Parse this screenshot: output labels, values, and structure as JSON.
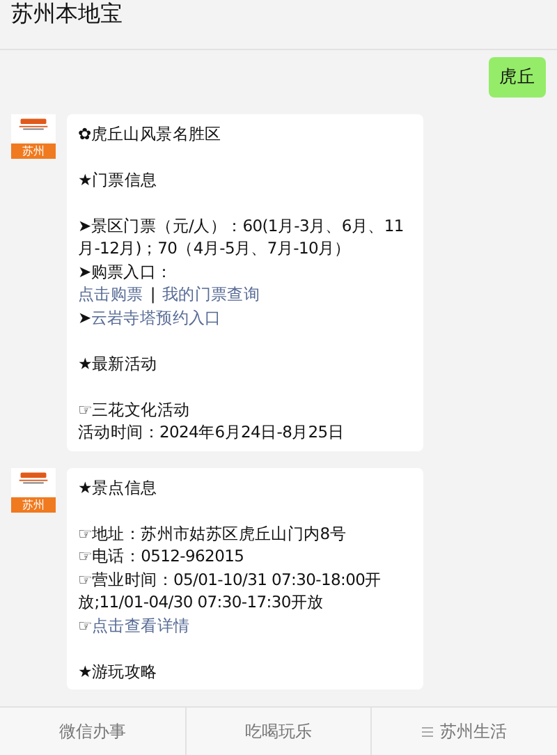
{
  "header": {
    "title": "苏州本地宝"
  },
  "messages": [
    {
      "kind": "user",
      "paragraphs": [
        [
          [
            {
              "text": "虎丘",
              "link": false
            }
          ]
        ]
      ]
    },
    {
      "kind": "account",
      "avatar_label": "苏州",
      "paragraphs": [
        [
          [
            {
              "text": "✿虎丘山风景名胜区",
              "link": false
            }
          ]
        ],
        [
          [
            {
              "text": "★门票信息",
              "link": false
            }
          ]
        ],
        [
          [
            {
              "text": "➤景区门票（元/人）：60(1月-3月、6月、11月-12月)；70（4月-5月、7月-10月）",
              "link": false
            }
          ],
          [
            {
              "text": "➤购票入口：",
              "link": false
            }
          ],
          [
            {
              "text": "点击购票",
              "link": true
            },
            {
              "text": "|",
              "link": false
            },
            {
              "text": "我的门票查询",
              "link": true
            }
          ],
          [
            {
              "text": "➤",
              "link": false
            },
            {
              "text": "云岩寺塔预约入口",
              "link": true
            }
          ]
        ],
        [
          [
            {
              "text": "★最新活动",
              "link": false
            }
          ]
        ],
        [
          [
            {
              "text": "☞三花文化活动",
              "link": false
            }
          ],
          [
            {
              "text": "活动时间：2024年6月24日-8月25日",
              "link": false
            }
          ]
        ]
      ]
    },
    {
      "kind": "account",
      "avatar_label": "苏州",
      "paragraphs": [
        [
          [
            {
              "text": "★景点信息",
              "link": false
            }
          ]
        ],
        [
          [
            {
              "text": "☞地址：苏州市姑苏区虎丘山门内8号",
              "link": false
            }
          ],
          [
            {
              "text": "☞电话：0512-962015",
              "link": false
            }
          ],
          [
            {
              "text": "☞营业时间：05/01-10/31 07:30-18:00开放;11/01-04/30 07:30-17:30开放",
              "link": false
            }
          ],
          [
            {
              "text": "☞",
              "link": false
            },
            {
              "text": "点击查看详情",
              "link": true
            }
          ]
        ],
        [
          [
            {
              "text": "★游玩攻略",
              "link": false
            }
          ]
        ]
      ]
    }
  ],
  "tabs": [
    {
      "label": "微信办事",
      "has_menu": false
    },
    {
      "label": "吃喝玩乐",
      "has_menu": false
    },
    {
      "label": "苏州生活",
      "has_menu": true
    }
  ]
}
